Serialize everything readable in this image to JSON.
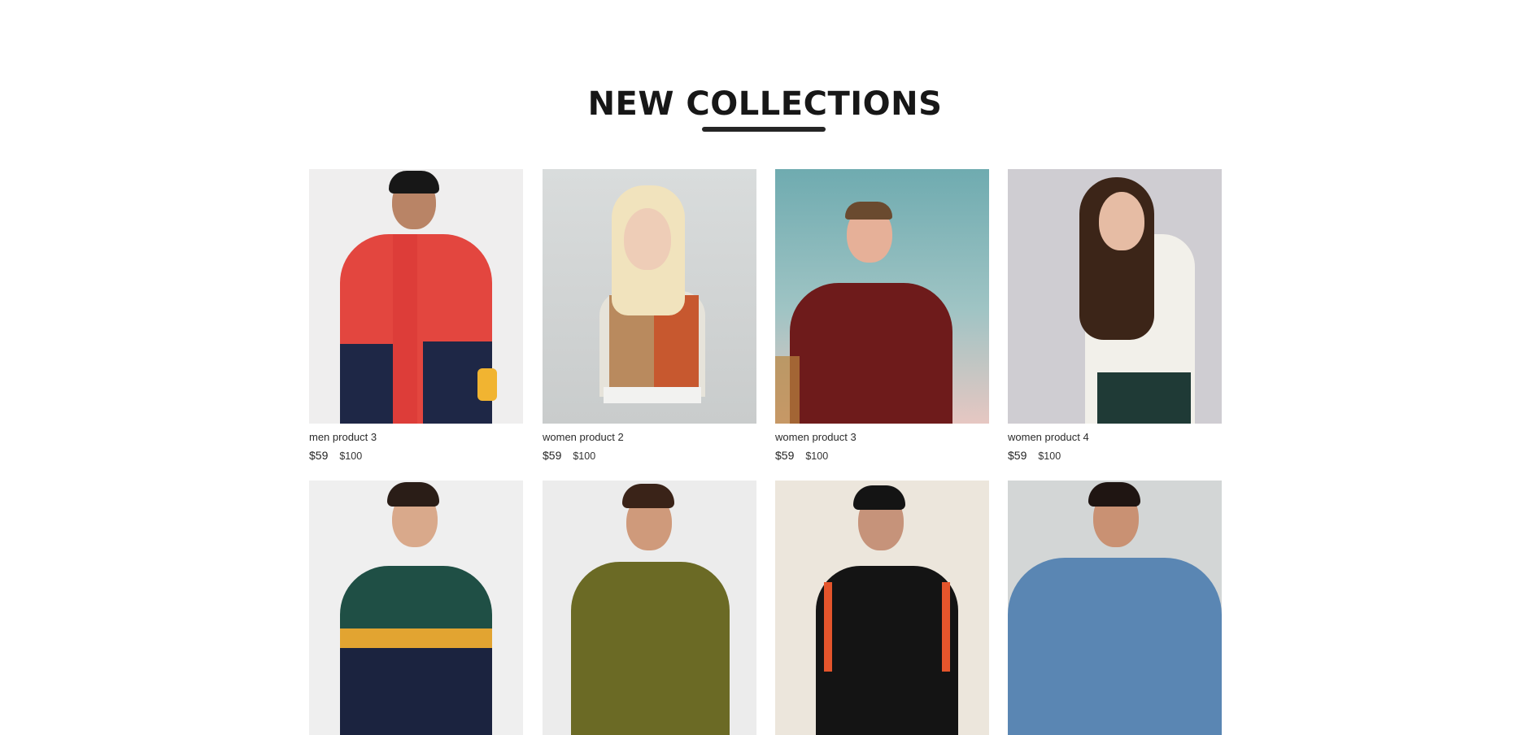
{
  "section": {
    "title": "NEW COLLECTIONS"
  },
  "products": [
    {
      "name": "men product 3",
      "new_price": "$59",
      "old_price": "$100",
      "image": "man-red-navy-urban-street-jacket"
    },
    {
      "name": "women product 2",
      "new_price": "$59",
      "old_price": "$100",
      "image": "woman-blonde-colorblock-sports-top"
    },
    {
      "name": "women product 3",
      "new_price": "$59",
      "old_price": "$100",
      "image": "woman-red-pattern-wrap-dress"
    },
    {
      "name": "women product 4",
      "new_price": "$59",
      "old_price": "$100",
      "image": "woman-white-turtleneck"
    },
    {
      "image": "boy-green-navy-track-jacket"
    },
    {
      "image": "boy-olive-quilted-jacket"
    },
    {
      "image": "boy-black-puma-track-jacket"
    },
    {
      "image": "boy-denim-jacket"
    }
  ],
  "colors": {
    "title": "#171717",
    "underline": "#252525",
    "text": "#2b2b2b"
  }
}
